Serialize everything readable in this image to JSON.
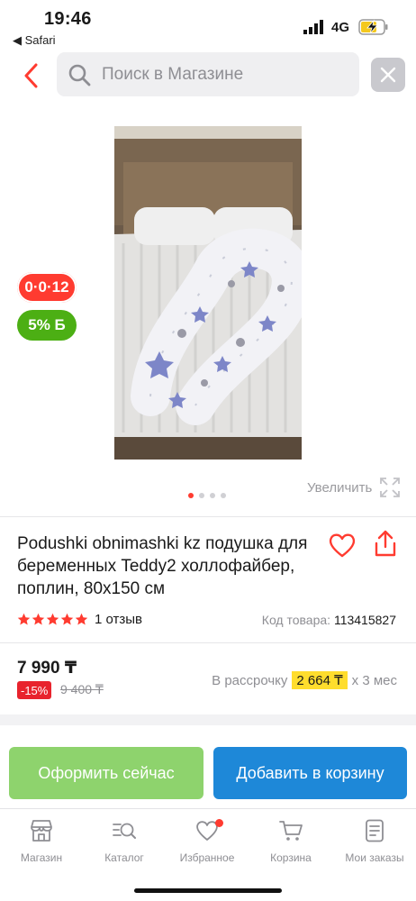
{
  "status_bar": {
    "time": "19:46",
    "back_app": "◀ Safari",
    "network": "4G"
  },
  "search": {
    "placeholder": "Поиск в Магазине"
  },
  "gallery": {
    "badge_installment": "0·0·12",
    "badge_bonus": "5% Б",
    "zoom_label": "Увеличить",
    "slides_total": 4,
    "slide_active": 1
  },
  "product": {
    "title": "Podushki obnimashki kz подушка для беременных Teddy2 холлофайбер, поплин, 80x150 см",
    "rating_stars": 5,
    "reviews": "1 отзыв",
    "sku_label": "Код товара:",
    "sku_value": "113415827",
    "price": "7 990 ₸",
    "discount": "-15%",
    "old_price": "9 400 ₸",
    "installment_prefix": "В рассрочку",
    "installment_amount": "2 664 ₸",
    "installment_suffix": "х 3 мес"
  },
  "actions": {
    "order_label": "Оформить сейчас",
    "cart_label": "Добавить в корзину"
  },
  "tabbar": {
    "items": [
      {
        "label": "Магазин",
        "icon": "shop-icon"
      },
      {
        "label": "Каталог",
        "icon": "catalog-search-icon"
      },
      {
        "label": "Избранное",
        "icon": "heart-icon"
      },
      {
        "label": "Корзина",
        "icon": "cart-icon"
      },
      {
        "label": "Мои заказы",
        "icon": "orders-icon"
      }
    ]
  },
  "colors": {
    "accent_red": "#ff3b30",
    "bonus_green": "#4caf14",
    "order_button": "#8ed36d",
    "cart_button": "#1e88d8",
    "installment_highlight": "#ffdd2d"
  }
}
